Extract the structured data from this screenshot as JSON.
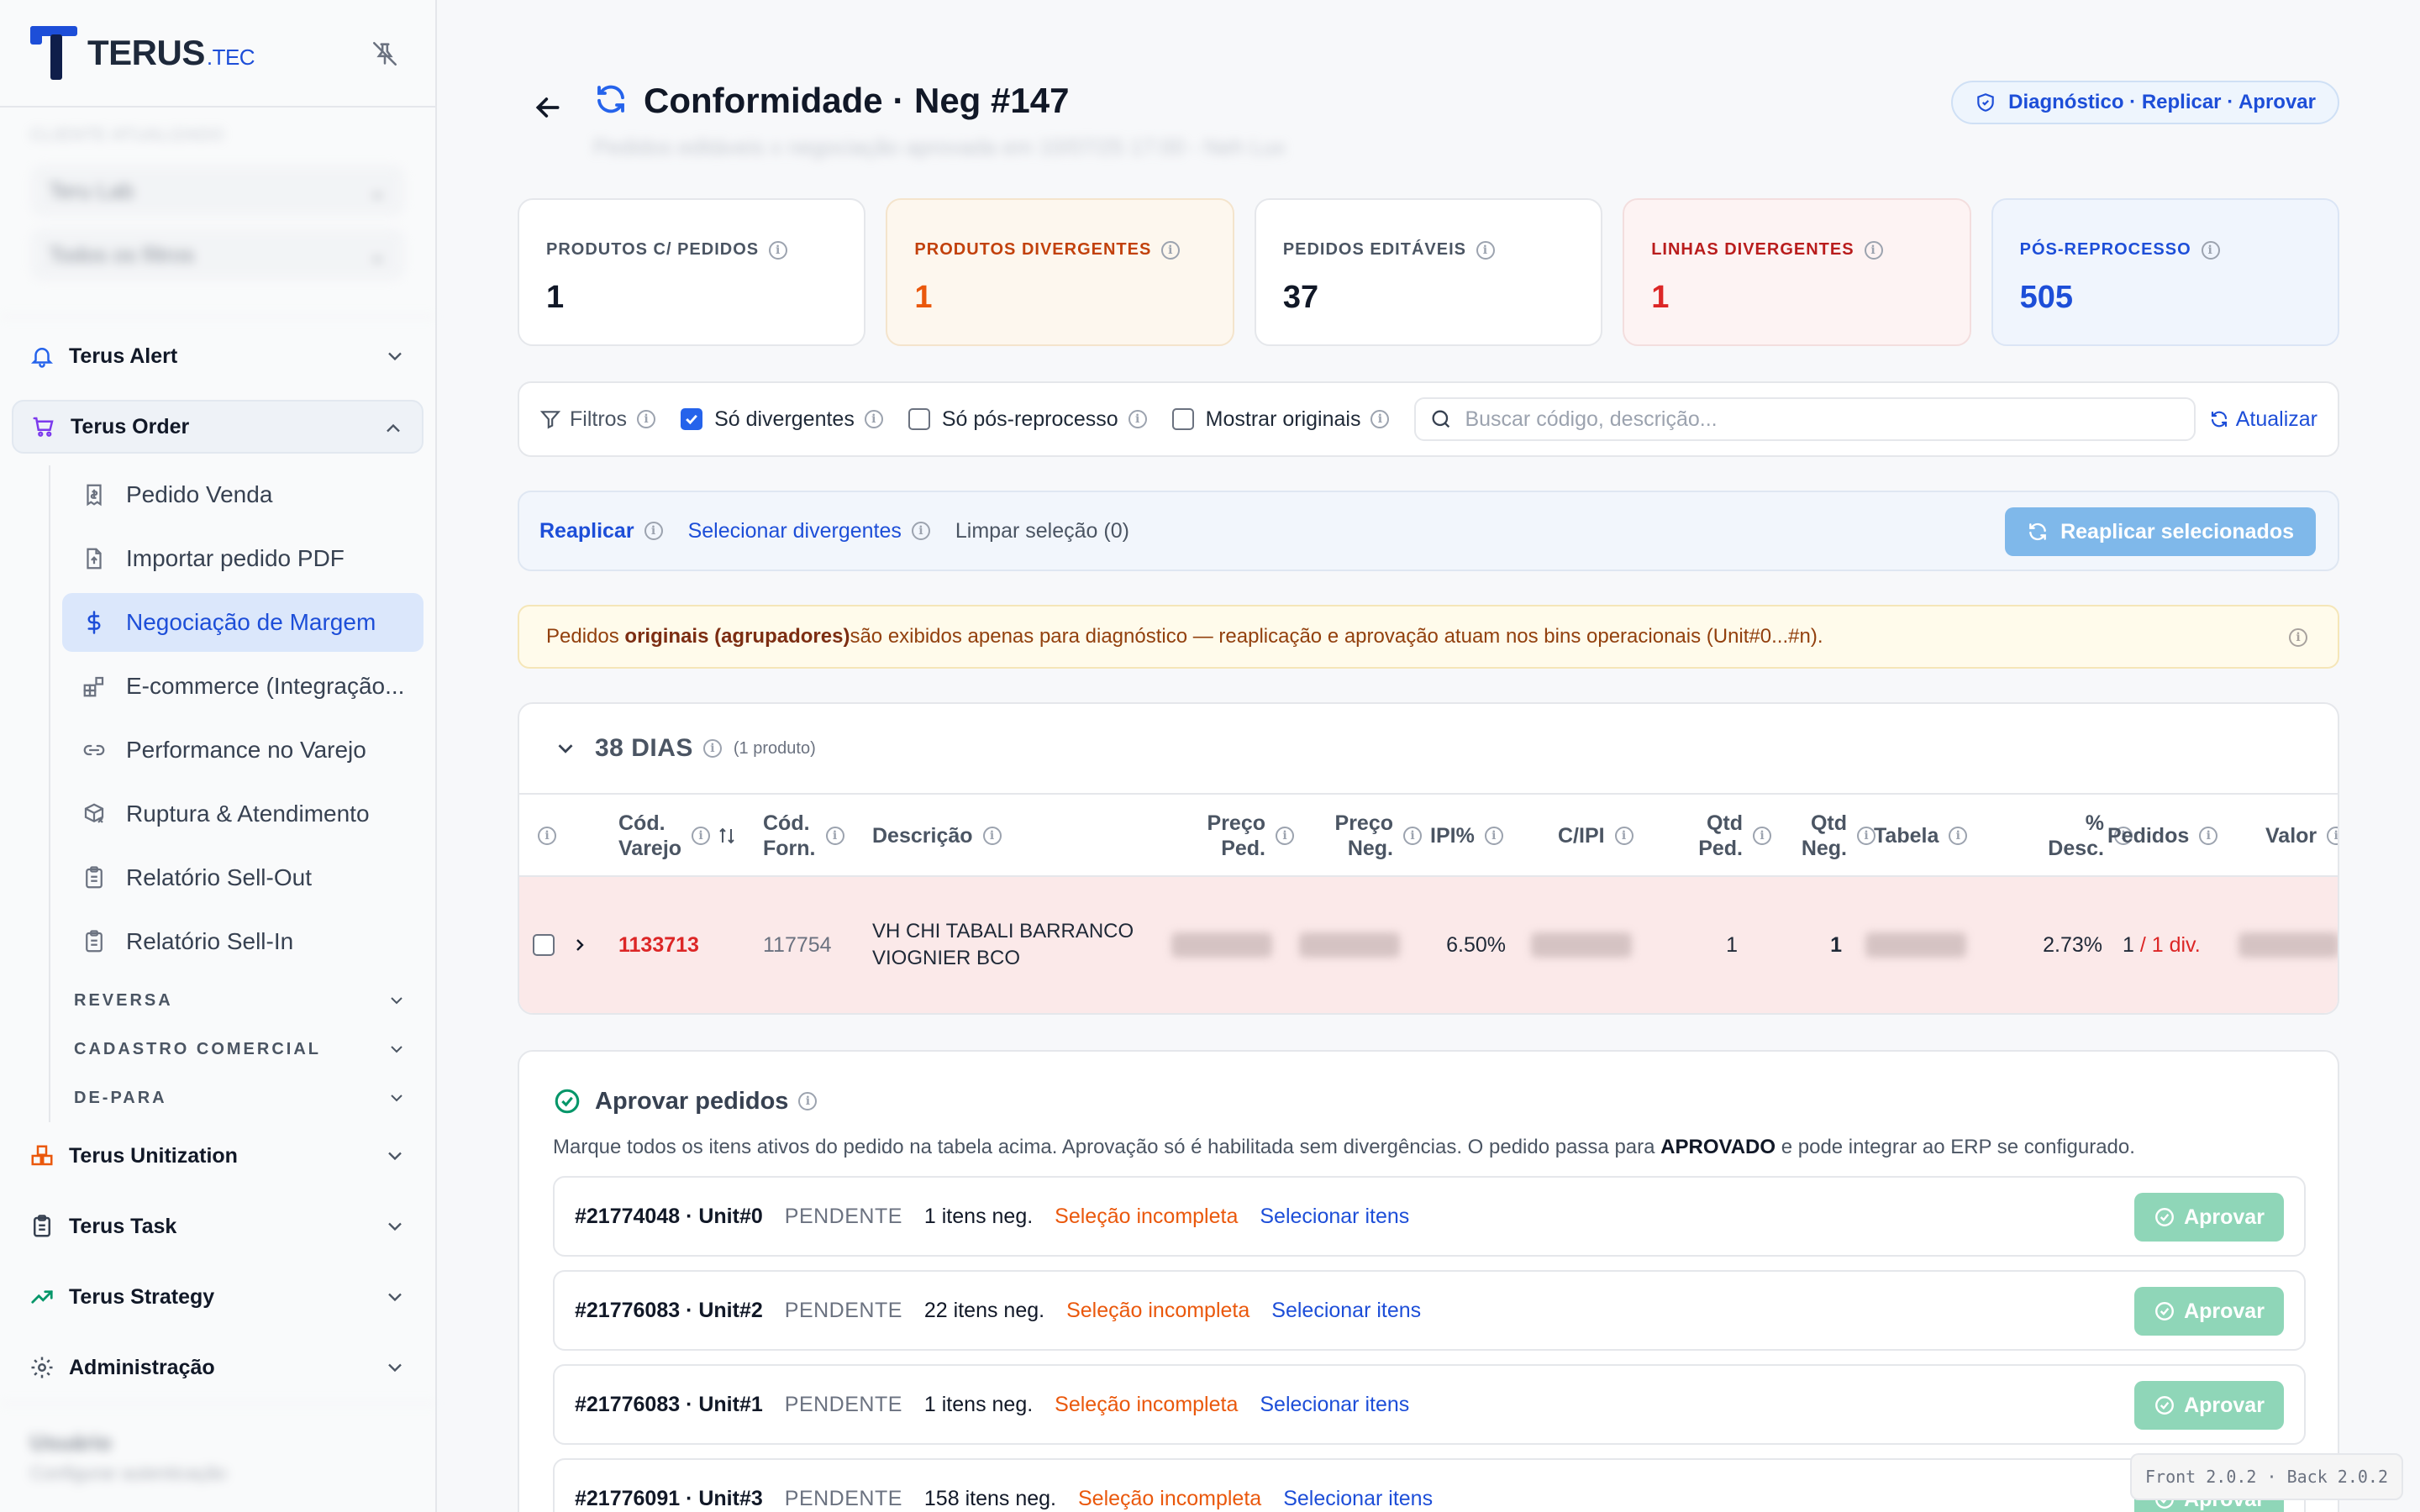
{
  "brand": {
    "name": "TERUS",
    "suffix": ".TEC"
  },
  "sidebar_filters": {
    "label": "CLIENTE ATUALIZADO",
    "select1": "Teru Lab",
    "select2": "Todos os filtros"
  },
  "nav": {
    "alert": "Terus Alert",
    "order": "Terus Order",
    "order_items": [
      "Pedido Venda",
      "Importar pedido PDF",
      "Negociação de Margem",
      "E-commerce (Integração...",
      "Performance no Varejo",
      "Ruptura & Atendimento",
      "Relatório Sell-Out",
      "Relatório Sell-In"
    ],
    "groups": [
      "REVERSA",
      "CADASTRO COMERCIAL",
      "DE-PARA"
    ],
    "unitization": "Terus Unitization",
    "task": "Terus Task",
    "strategy": "Terus Strategy",
    "admin": "Administração"
  },
  "user": {
    "name": "Usuário",
    "role": "Configurar autenticação"
  },
  "header": {
    "title": "Conformidade · Neg #147",
    "subtitle": "Pedidos editáveis x negociação aprovada em 10/07/25 17:00 - Neh Lux",
    "pill": "Diagnóstico · Replicar · Aprovar"
  },
  "kpis": [
    {
      "label": "PRODUTOS C/ PEDIDOS",
      "value": "1"
    },
    {
      "label": "PRODUTOS DIVERGENTES",
      "value": "1"
    },
    {
      "label": "PEDIDOS EDITÁVEIS",
      "value": "37"
    },
    {
      "label": "LINHAS DIVERGENTES",
      "value": "1"
    },
    {
      "label": "PÓS-REPROCESSO",
      "value": "505"
    }
  ],
  "filterbar": {
    "filters_label": "Filtros",
    "only_divergent": "Só divergentes",
    "only_post": "Só pós-reprocesso",
    "show_originals": "Mostrar originais",
    "search_placeholder": "Buscar código, descrição...",
    "refresh": "Atualizar"
  },
  "actionbar": {
    "replicate": "Reaplicar",
    "select_divergent": "Selecionar divergentes",
    "clear_selection": "Limpar seleção (0)",
    "replicate_selected": "Reaplicar selecionados"
  },
  "notice": {
    "prefix": "Pedidos ",
    "bold": "originais (agrupadores)",
    "suffix": " são exibidos apenas para diagnóstico — reaplicação e aprovação atuam nos bins operacionais (Unit#0...#n)."
  },
  "group": {
    "title": "38 DIAS",
    "count": "(1 produto)"
  },
  "table": {
    "columns": {
      "cod_varejo": [
        "Cód.",
        "Varejo"
      ],
      "cod_forn": [
        "Cód.",
        "Forn."
      ],
      "descricao": "Descrição",
      "preco_ped": [
        "Preço",
        "Ped."
      ],
      "preco_neg": [
        "Preço",
        "Neg."
      ],
      "ipi": "IPI%",
      "cipi": "C/IPI",
      "qtd_ped": [
        "Qtd",
        "Ped."
      ],
      "qtd_neg": [
        "Qtd",
        "Neg."
      ],
      "tabela": "Tabela",
      "desc": [
        "%",
        "Desc."
      ],
      "pedidos": "Pedidos",
      "valor": "Valor"
    },
    "rows": [
      {
        "cod_varejo": "1133713",
        "cod_forn": "117754",
        "descricao_1": "VH CHI TABALI BARRANCO",
        "descricao_2": "VIOGNIER BCO",
        "ipi": "6.50%",
        "qtd_ped": "1",
        "qtd_neg": "1",
        "desc": "2.73%",
        "pedidos": "1",
        "pedidos_div": "/ 1 div."
      }
    ]
  },
  "approve": {
    "title": "Aprovar pedidos",
    "desc_prefix": "Marque todos os itens ativos do pedido na tabela acima. Aprovação só é habilitada sem divergências. O pedido passa para ",
    "desc_bold": "APROVADO",
    "desc_suffix": " e pode integrar ao ERP se configurado.",
    "button": "Aprovar",
    "orders": [
      {
        "id": "#21774048 · Unit#0",
        "status": "PENDENTE",
        "items": "1 itens neg.",
        "warn": "Seleção incompleta",
        "link": "Selecionar itens"
      },
      {
        "id": "#21776083 · Unit#2",
        "status": "PENDENTE",
        "items": "22 itens neg.",
        "warn": "Seleção incompleta",
        "link": "Selecionar itens"
      },
      {
        "id": "#21776083 · Unit#1",
        "status": "PENDENTE",
        "items": "1 itens neg.",
        "warn": "Seleção incompleta",
        "link": "Selecionar itens"
      },
      {
        "id": "#21776091 · Unit#3",
        "status": "PENDENTE",
        "items": "158 itens neg.",
        "warn": "Seleção incompleta",
        "link": "Selecionar itens"
      }
    ]
  },
  "version": "Front 2.0.2 · Back 2.0.2",
  "colors": {
    "accent": "#2563eb",
    "divergent": "#dc2626",
    "warning": "#ea580c",
    "approve": "#8fd6b8"
  }
}
